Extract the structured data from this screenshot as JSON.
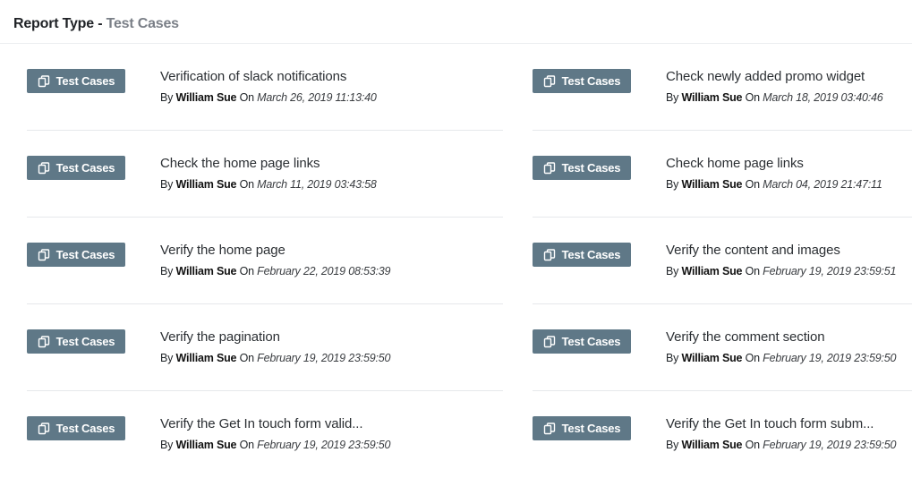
{
  "header": {
    "label": "Report Type - ",
    "value": "Test Cases"
  },
  "badge_label": "Test Cases",
  "by_label": "By",
  "on_label": "On",
  "items": [
    {
      "title": "Verification of slack notifications",
      "author": "William Sue",
      "date": "March 26, 2019 11:13:40"
    },
    {
      "title": "Check newly added promo widget",
      "author": "William Sue",
      "date": "March 18, 2019 03:40:46"
    },
    {
      "title": "Check the home page links",
      "author": "William Sue",
      "date": "March 11, 2019 03:43:58"
    },
    {
      "title": "Check home page links",
      "author": "William Sue",
      "date": "March 04, 2019 21:47:11"
    },
    {
      "title": "Verify the home page",
      "author": "William Sue",
      "date": "February 22, 2019 08:53:39"
    },
    {
      "title": "Verify the content and images",
      "author": "William Sue",
      "date": "February 19, 2019 23:59:51"
    },
    {
      "title": "Verify the pagination",
      "author": "William Sue",
      "date": "February 19, 2019 23:59:50"
    },
    {
      "title": "Verify the comment section",
      "author": "William Sue",
      "date": "February 19, 2019 23:59:50"
    },
    {
      "title": "Verify the Get In touch form valid...",
      "author": "William Sue",
      "date": "February 19, 2019 23:59:50"
    },
    {
      "title": "Verify the Get In touch form subm...",
      "author": "William Sue",
      "date": "February 19, 2019 23:59:50"
    }
  ]
}
